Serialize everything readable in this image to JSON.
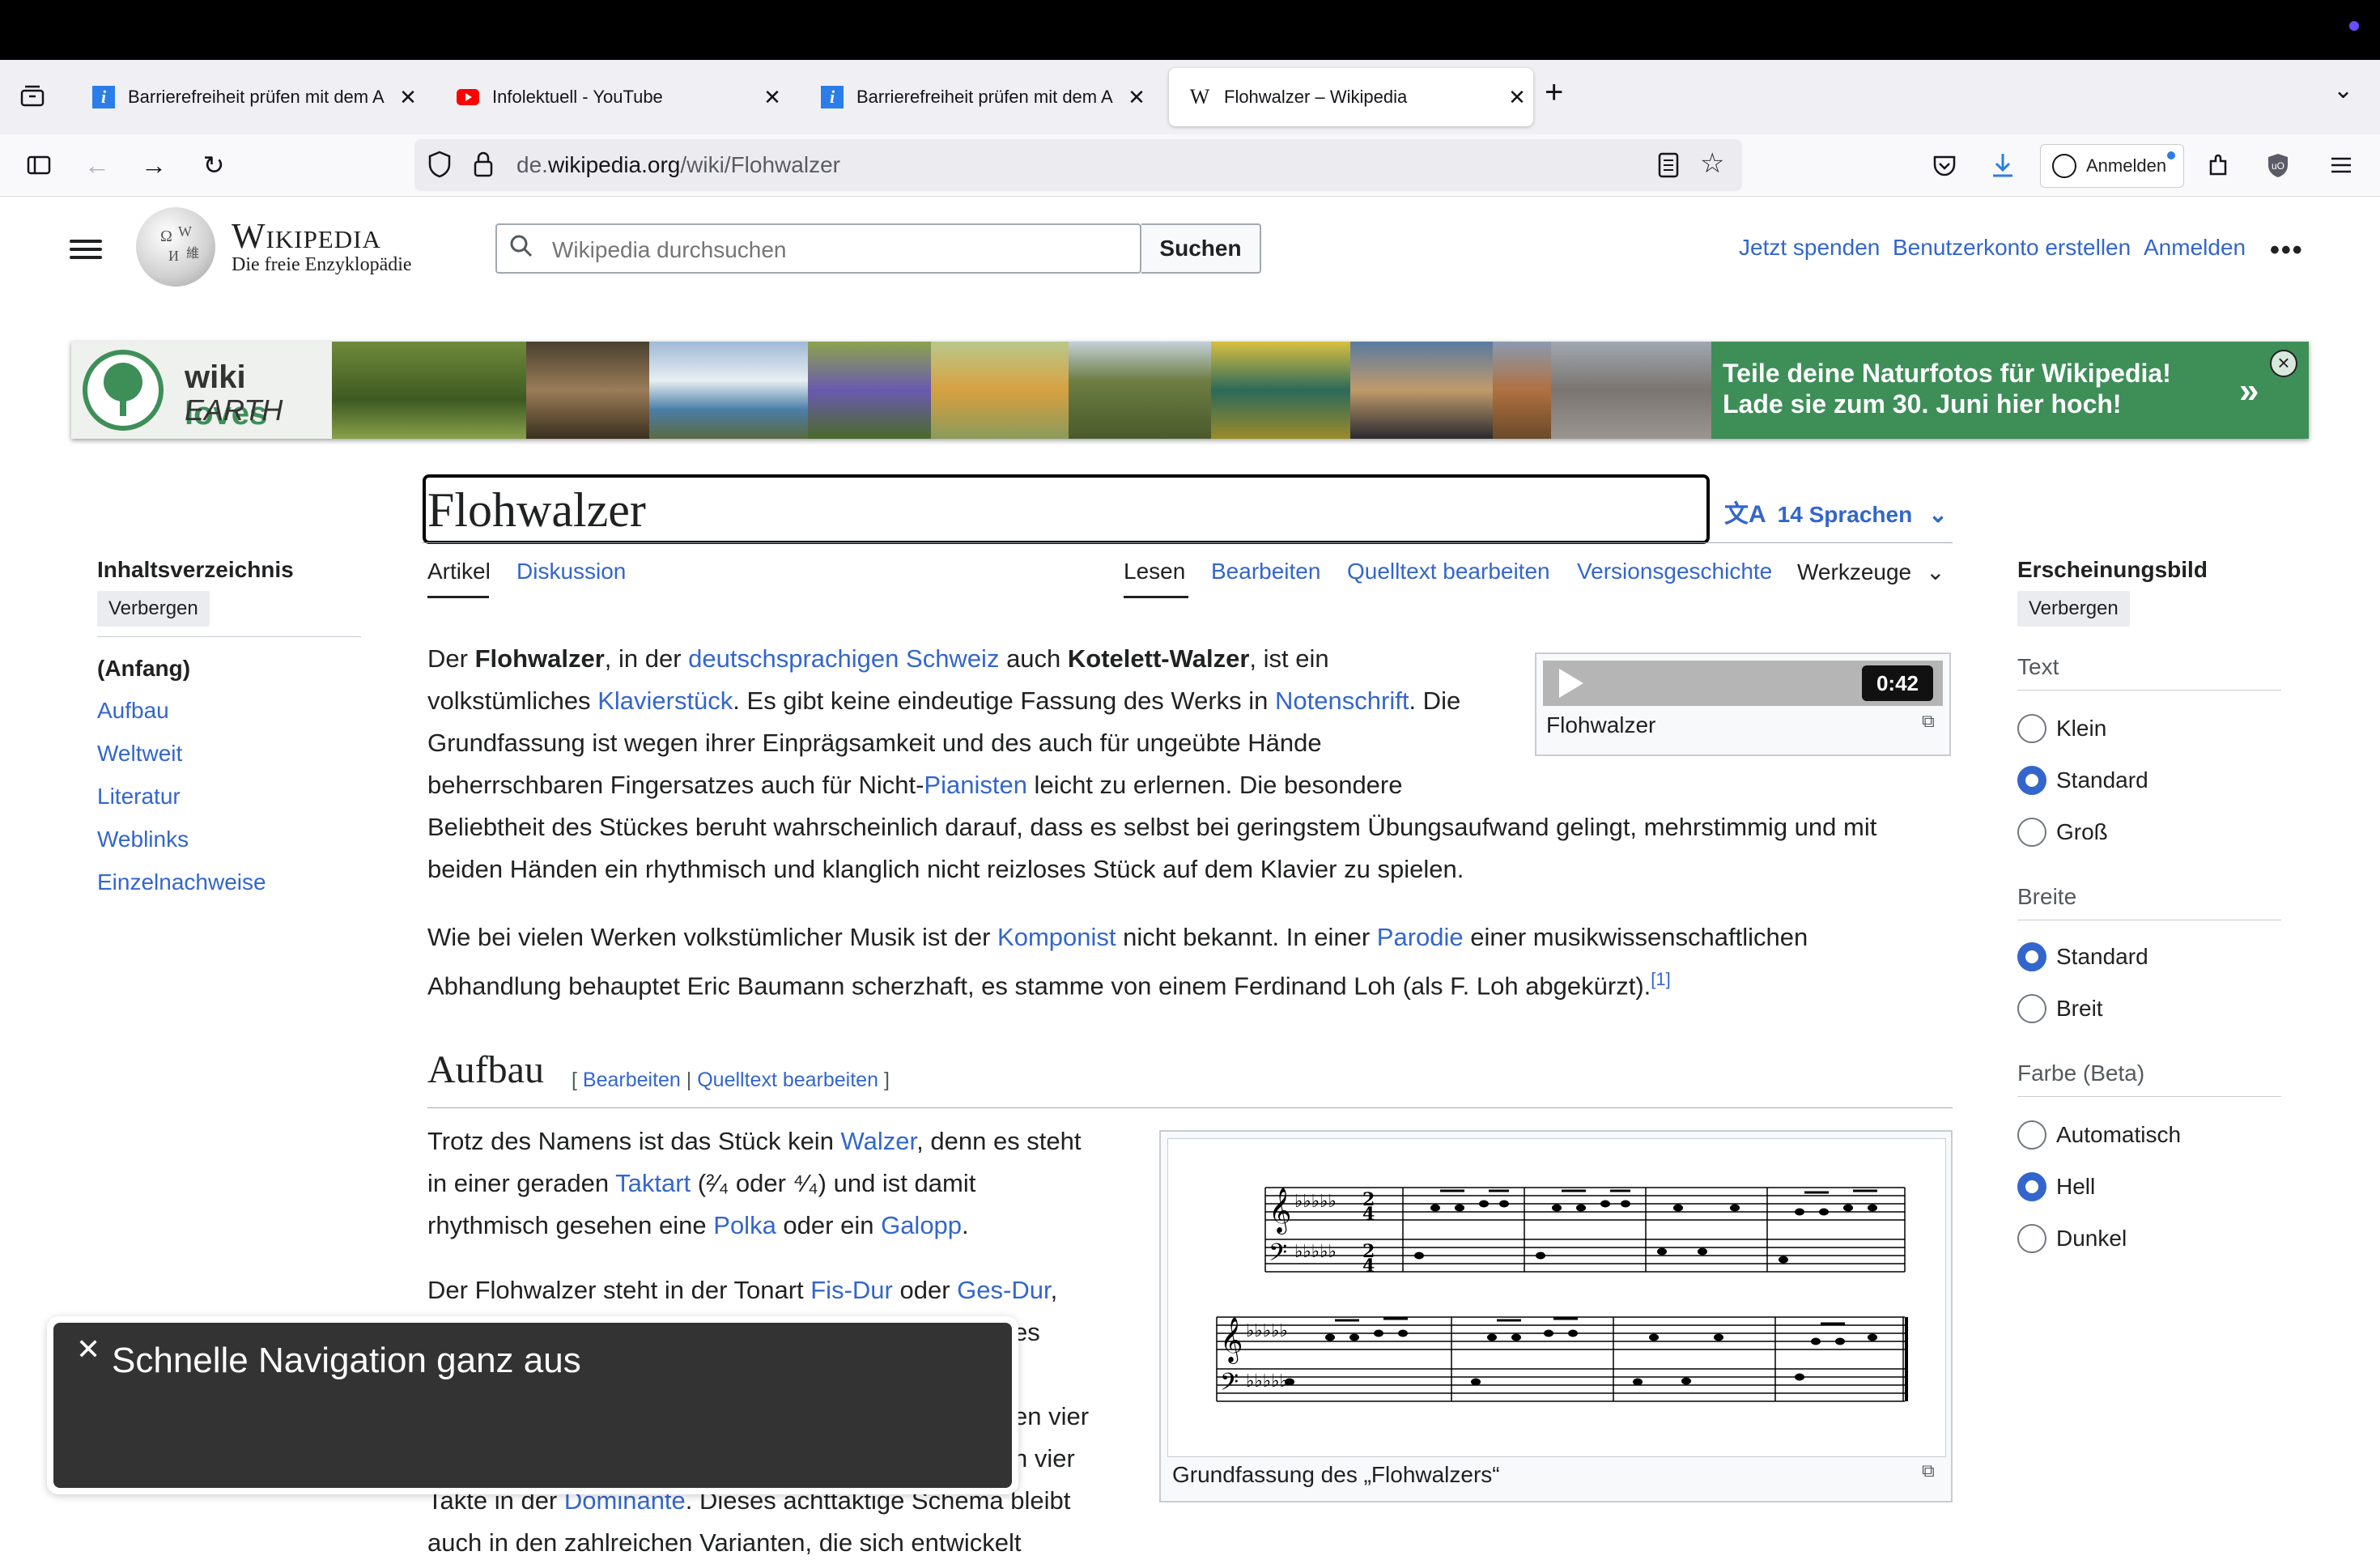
{
  "tabs": [
    {
      "title": "Barrierefreiheit prüfen mit dem A",
      "favicon": "i",
      "active": false
    },
    {
      "title": "Infolektuell - YouTube",
      "favicon": "youtube",
      "active": false
    },
    {
      "title": "Barrierefreiheit prüfen mit dem A",
      "favicon": "i",
      "active": false
    },
    {
      "title": "Flohwalzer – Wikipedia",
      "favicon": "W",
      "active": true
    }
  ],
  "url": {
    "domain_prefix": "de.",
    "domain": "wikipedia.org",
    "path": "/wiki/Flohwalzer"
  },
  "browser": {
    "account_label": "Anmelden"
  },
  "wiki": {
    "wordmark": "Wikipedia",
    "tagline": "Die freie Enzyklopädie",
    "search_placeholder": "Wikipedia durchsuchen",
    "search_button": "Suchen",
    "links": [
      "Jetzt spenden",
      "Benutzerkonto erstellen",
      "Anmelden"
    ]
  },
  "banner": {
    "brand_line1_a": "wiki",
    "brand_line1_b": "loves",
    "brand_line2": "EARTH",
    "line1": "Teile deine Naturfotos für Wikipedia!",
    "line2": "Lade sie zum 30. Juni hier hoch!",
    "chevron": "»",
    "close": "×"
  },
  "title": "Flohwalzer",
  "languages": "14 Sprachen",
  "article_tabs": {
    "artikel": "Artikel",
    "diskussion": "Diskussion"
  },
  "view_tabs": {
    "lesen": "Lesen",
    "bearbeiten": "Bearbeiten",
    "quelltext": "Quelltext bearbeiten",
    "versionen": "Versionsgeschichte",
    "werkzeuge": "Werkzeuge"
  },
  "toc": {
    "title": "Inhaltsverzeichnis",
    "hide": "Verbergen",
    "start": "(Anfang)",
    "items": [
      "Aufbau",
      "Weltweit",
      "Literatur",
      "Weblinks",
      "Einzelnachweise"
    ]
  },
  "audio": {
    "time": "0:42",
    "caption": "Flohwalzer"
  },
  "para1": {
    "t1": "Der ",
    "b1": "Flohwalzer",
    "t2": ", in der ",
    "l1": "deutschsprachigen Schweiz",
    "t3": " auch ",
    "b2": "Kotelett-Walzer",
    "t4": ", ist ein",
    "t5": "volkstümliches ",
    "l2": "Klavierstück",
    "t6": ". Es gibt keine eindeutige Fassung des Werks in ",
    "l3": "Notenschrift",
    "t7": ". Die",
    "t8": "Grundfassung ist wegen ihrer Einprägsamkeit und des auch für ungeübte Hände",
    "t9": "beherrschbaren Fingersatzes auch für Nicht-",
    "l4": "Pianisten",
    "t10": " leicht zu erlernen. Die besondere",
    "t11": "Beliebtheit des Stückes beruht wahrscheinlich darauf, dass es selbst bei geringstem Übungsaufwand gelingt, mehrstimmig und mit",
    "t12": "beiden Händen ein rhythmisch und klanglich nicht reizloses Stück auf dem Klavier zu spielen."
  },
  "para2": {
    "t1": "Wie bei vielen Werken volkstümlicher Musik ist der ",
    "l1": "Komponist",
    "t2": " nicht bekannt. In einer ",
    "l2": "Parodie",
    "t3": " einer musikwissenschaftlichen",
    "t4": "Abhandlung behauptet Eric Baumann scherzhaft, es stamme von einem Ferdinand Loh (als F. Loh abgekürzt).",
    "ref": "[1]"
  },
  "section": {
    "heading": "Aufbau",
    "edit": "Bearbeiten",
    "source_edit": "Quelltext bearbeiten"
  },
  "para3": {
    "t1": "Trotz des Namens ist das Stück kein ",
    "l1": "Walzer",
    "t2": ", denn es steht",
    "t3": "in einer geraden ",
    "l2": "Taktart",
    "t4": " (²⁄₄ oder ⁴⁄₄) und ist damit",
    "t5": "rhythmisch gesehen eine ",
    "l3": "Polka",
    "t6": " oder ein ",
    "l4": "Galopp",
    "t7": "."
  },
  "para4": {
    "t1": "Der Flohwalzer steht in der Tonart ",
    "l1": "Fis-Dur",
    "t2": " oder ",
    "l2": "Ges-Dur",
    "t3": ",",
    "t4": "es",
    "t5": "en vier",
    "t6": "n vier",
    "t7": "Takte in der ",
    "l3": "Dominante",
    "t8": ". Dieses achttaktige Schema bleibt",
    "t9": "auch in den zahlreichen Varianten, die sich entwickelt"
  },
  "figure": {
    "caption": "Grundfassung des „Flohwalzers“"
  },
  "appearance": {
    "title": "Erscheinungsbild",
    "hide": "Verbergen",
    "text_label": "Text",
    "text_options": [
      "Klein",
      "Standard",
      "Groß"
    ],
    "text_selected": "Standard",
    "width_label": "Breite",
    "width_options": [
      "Standard",
      "Breit"
    ],
    "width_selected": "Standard",
    "color_label": "Farbe (Beta)",
    "color_options": [
      "Automatisch",
      "Hell",
      "Dunkel"
    ],
    "color_selected": "Hell"
  },
  "toast": {
    "text": "Schnelle Navigation ganz aus"
  },
  "colors": {
    "link": "#3366cc",
    "banner": "#3e8e58",
    "toast": "#333333"
  }
}
